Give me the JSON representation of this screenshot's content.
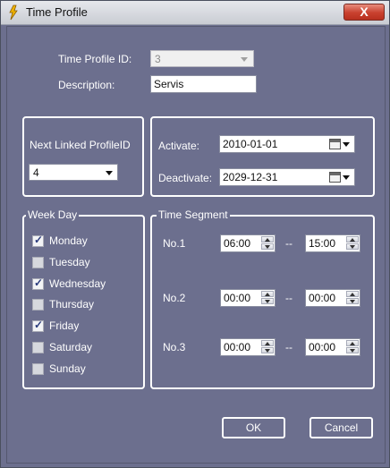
{
  "window": {
    "title": "Time Profile",
    "close_label": "X"
  },
  "profile": {
    "id_label": "Time Profile ID:",
    "id_value": "3",
    "description_label": "Description:",
    "description_value": "Servis"
  },
  "linked": {
    "label": "Next Linked ProfileID",
    "value": "4"
  },
  "dates": {
    "activate_label": "Activate:",
    "activate_value": "2010-01-01",
    "deactivate_label": "Deactivate:",
    "deactivate_value": "2029-12-31"
  },
  "weekday": {
    "title": "Week Day",
    "days": [
      {
        "label": "Monday",
        "checked": true
      },
      {
        "label": "Tuesday",
        "checked": false
      },
      {
        "label": "Wednesday",
        "checked": true
      },
      {
        "label": "Thursday",
        "checked": false
      },
      {
        "label": "Friday",
        "checked": true
      },
      {
        "label": "Saturday",
        "checked": false
      },
      {
        "label": "Sunday",
        "checked": false
      }
    ]
  },
  "segments": {
    "title": "Time Segment",
    "dash": "--",
    "rows": [
      {
        "label": "No.1",
        "start": "06:00",
        "end": "15:00"
      },
      {
        "label": "No.2",
        "start": "00:00",
        "end": "00:00"
      },
      {
        "label": "No.3",
        "start": "00:00",
        "end": "00:00"
      }
    ]
  },
  "buttons": {
    "ok": "OK",
    "cancel": "Cancel"
  },
  "colors": {
    "background": "#6c6f8e",
    "close": "#c8402e",
    "check": "#2a3b7c"
  }
}
